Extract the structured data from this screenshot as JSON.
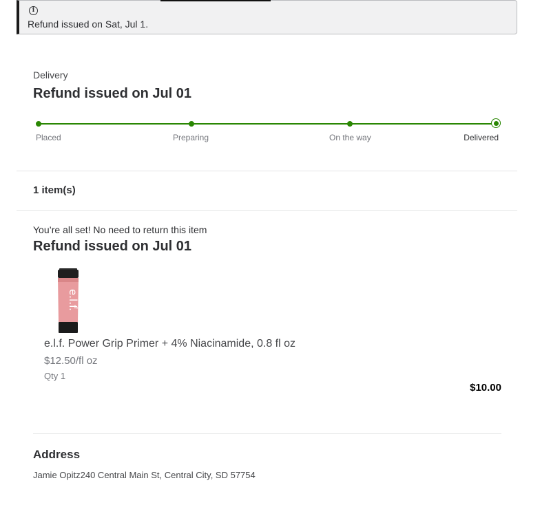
{
  "alert": {
    "icon": "info-icon",
    "text": "Refund issued on Sat, Jul 1."
  },
  "delivery": {
    "label": "Delivery",
    "status_title": "Refund issued on Jul 01",
    "steps": [
      {
        "label": "Placed",
        "done": true
      },
      {
        "label": "Preparing",
        "done": true
      },
      {
        "label": "On the way",
        "done": true
      },
      {
        "label": "Delivered",
        "done": true,
        "current": true
      }
    ],
    "progress_fraction": 1.0
  },
  "items": {
    "count_label": "1 item(s)",
    "return_note": "You’re all set! No need to return this item",
    "status_title": "Refund issued on Jul 01",
    "product": {
      "name": "e.l.f. Power Grip Primer + 4% Niacinamide, 0.8 fl oz",
      "unit_price": "$12.50/fl oz",
      "quantity": "Qty 1",
      "price": "$10.00",
      "image_brand_text": "e.l.f."
    }
  },
  "address": {
    "heading": "Address",
    "text": "Jamie Opitz240 Central Main St, Central City, SD 57754"
  },
  "colors": {
    "accent_green": "#2a8703",
    "text_primary": "#2e2f32",
    "text_secondary": "#74767c"
  }
}
